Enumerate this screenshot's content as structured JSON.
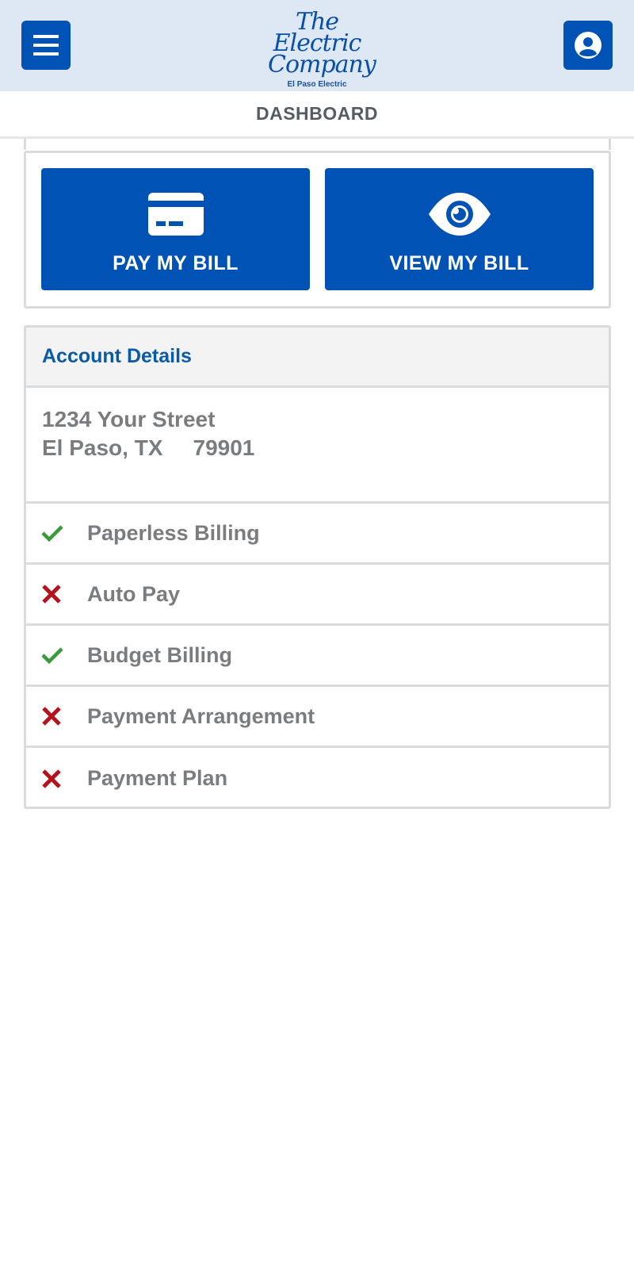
{
  "header": {
    "logo_line1": "The Electric",
    "logo_line2": "Company",
    "logo_sub": "El Paso Electric",
    "menu_icon": "hamburger-menu-icon",
    "profile_icon": "user-profile-icon"
  },
  "page": {
    "title": "DASHBOARD"
  },
  "actions": {
    "pay_label": "PAY MY BILL",
    "pay_icon": "credit-card-icon",
    "view_label": "VIEW MY BILL",
    "view_icon": "eye-icon"
  },
  "account": {
    "title": "Account Details",
    "street": "1234 Your Street",
    "city_state": "El Paso, TX",
    "zip": "79901",
    "features": [
      {
        "label": "Paperless Billing",
        "enabled": true
      },
      {
        "label": "Auto Pay",
        "enabled": false
      },
      {
        "label": "Budget Billing",
        "enabled": true
      },
      {
        "label": "Payment Arrangement",
        "enabled": false
      },
      {
        "label": "Payment Plan",
        "enabled": false
      }
    ]
  },
  "colors": {
    "brand_blue": "#0052b4",
    "header_bg": "#dde8f4",
    "check_green": "#3a9a3a",
    "cross_red": "#b3141b",
    "text_gray": "#7a7d80"
  }
}
